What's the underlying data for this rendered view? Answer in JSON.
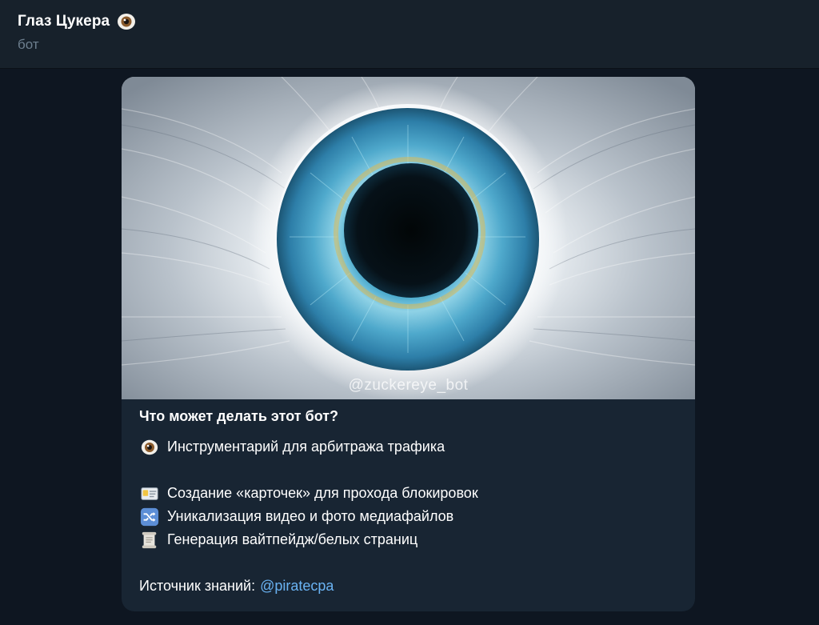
{
  "header": {
    "title": "Глаз Цукера",
    "title_emoji": "eye-icon",
    "subtitle": "бот"
  },
  "card": {
    "watermark": "@zuckereye_bot",
    "heading": "Что может делать этот бот?",
    "lines": [
      {
        "icon": "eye-icon",
        "text": "Инструментарий для арбитража трафика"
      },
      {
        "icon": "id-card-icon",
        "text": "Создание «карточек» для прохода блокировок"
      },
      {
        "icon": "shuffle-icon",
        "text": "Уникализация видео и фото медиафайлов"
      },
      {
        "icon": "scroll-icon",
        "text": "Генерация вайтпейдж/белых страниц"
      }
    ],
    "source_label": "Источник знаний:",
    "source_link": "@piratecpa"
  },
  "colors": {
    "background": "#0e1621",
    "header": "#17212b",
    "card": "#182533",
    "link": "#6ab3f3",
    "subtitle": "#6d7f8f"
  }
}
